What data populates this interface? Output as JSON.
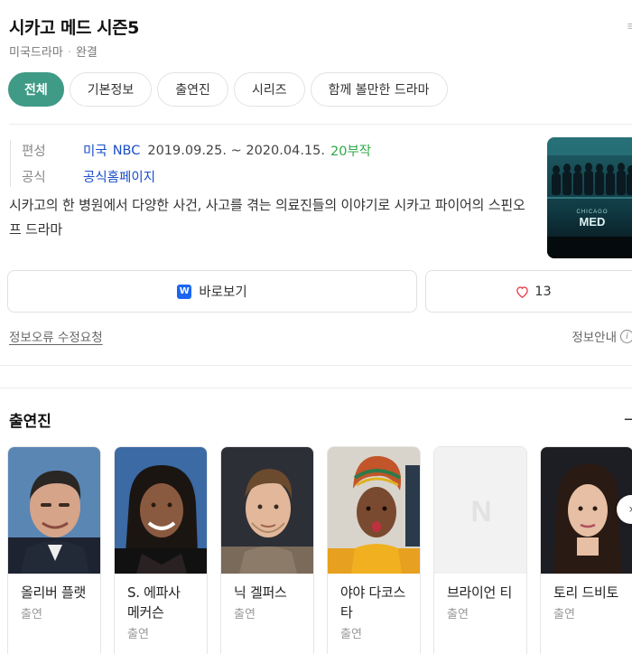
{
  "header": {
    "title": "시카고 메드 시즌5",
    "genre": "미국드라마",
    "status": "완결"
  },
  "tabs": [
    {
      "label": "전체",
      "active": true
    },
    {
      "label": "기본정보",
      "active": false
    },
    {
      "label": "출연진",
      "active": false
    },
    {
      "label": "시리즈",
      "active": false
    },
    {
      "label": "함께 볼만한 드라마",
      "active": false
    }
  ],
  "info": {
    "broadcast_key": "편성",
    "country": "미국",
    "network": "NBC",
    "period": "2019.09.25. ~ 2020.04.15.",
    "episodes": "20부작",
    "official_key": "공식",
    "official_link": "공식홈페이지"
  },
  "description": "시카고의 한 병원에서 다양한 사건, 사고를 겪는 의료진들의 이야기로 시카고 파이어의 스핀오프 드라마",
  "poster": {
    "logo_text": "CHICAGO",
    "logo_text2": "MED"
  },
  "actions": {
    "watch_label": "바로보기",
    "watch_logo": "W",
    "like_count": "13"
  },
  "footer_links": {
    "report": "정보오류 수정요청",
    "info_guide": "정보안내",
    "info_icon": "i"
  },
  "cast_section": {
    "title": "출연진",
    "members": [
      {
        "name": "올리버 플랫",
        "role": "출연"
      },
      {
        "name": "S. 에파사 메커슨",
        "role": "출연"
      },
      {
        "name": "닉 겔퍼스",
        "role": "출연"
      },
      {
        "name": "야야 다코스타",
        "role": "출연"
      },
      {
        "name": "브라이언 티",
        "role": "출연"
      },
      {
        "name": "토리 드비토",
        "role": "출연"
      }
    ],
    "placeholder_letter": "N"
  },
  "colors": {
    "accent": "#3f9a86",
    "link": "#1a4fc9",
    "episodes": "#2eaa48",
    "watch_logo": "#1a66f0",
    "heart": "#e8343f"
  }
}
